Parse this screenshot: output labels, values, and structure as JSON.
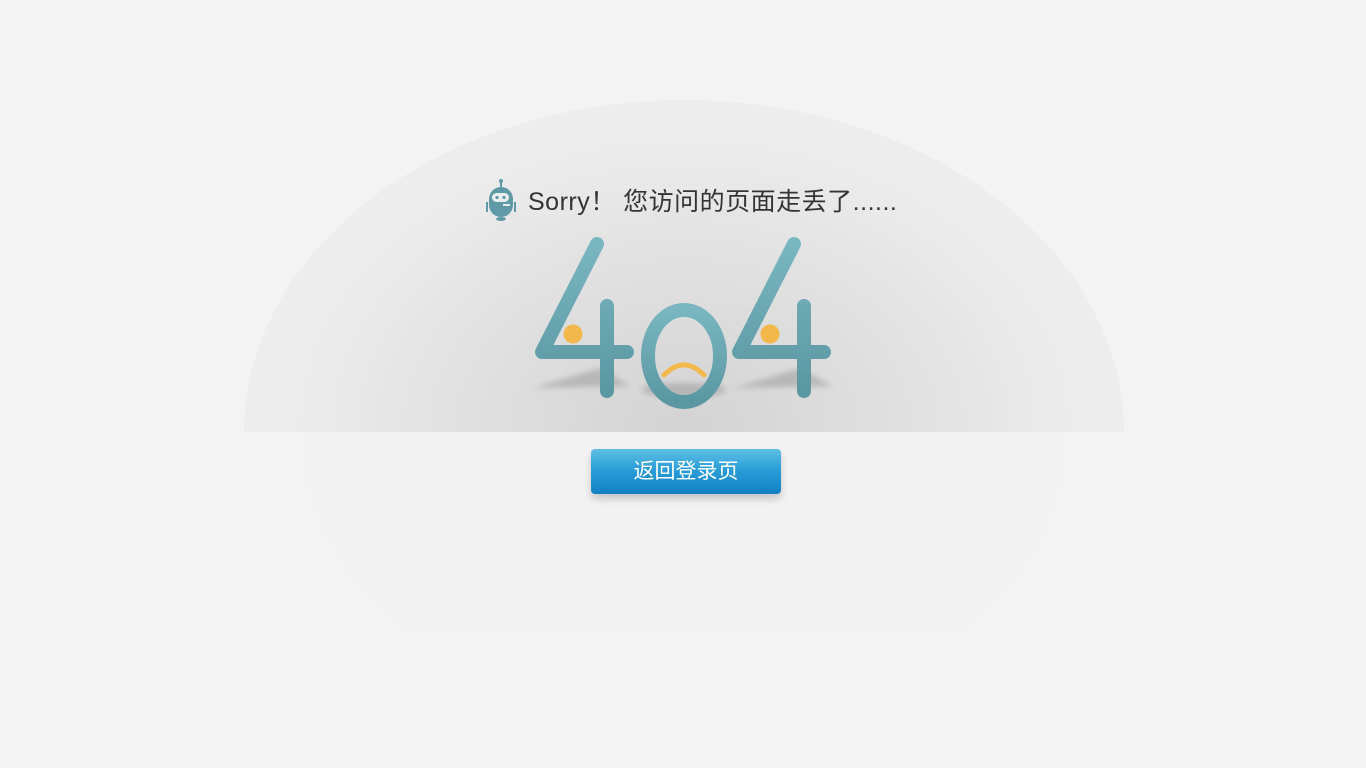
{
  "message": {
    "text": "Sorry！ 您访问的页面走丢了......",
    "icon": "robot-icon"
  },
  "error_code": "404",
  "button": {
    "label": "返回登录页"
  },
  "colors": {
    "digit": "#6aa8b3",
    "accent": "#f2b84b",
    "button": "#2a9ed8",
    "background": "#f3f3f3"
  }
}
